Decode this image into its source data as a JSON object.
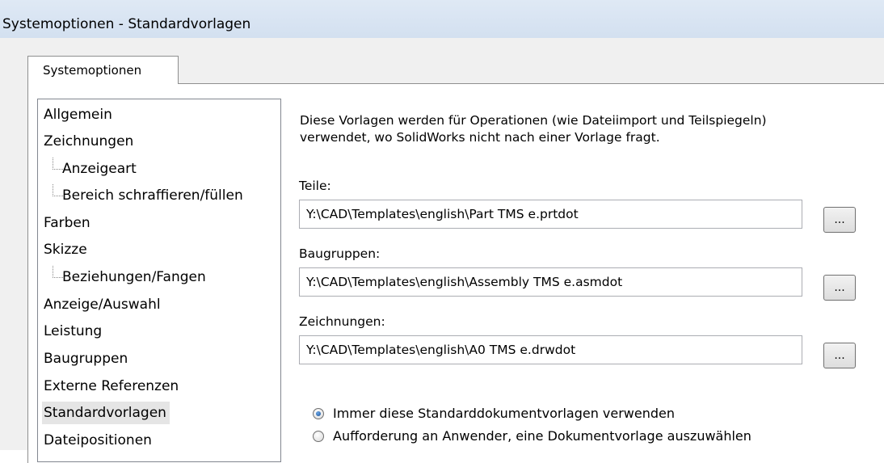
{
  "window": {
    "title": "Systemoptionen - Standardvorlagen"
  },
  "tab": {
    "label": "Systemoptionen"
  },
  "tree": {
    "items": [
      {
        "label": "Allgemein"
      },
      {
        "label": "Zeichnungen"
      },
      {
        "label": "Anzeigeart"
      },
      {
        "label": "Bereich schraffieren/füllen"
      },
      {
        "label": "Farben"
      },
      {
        "label": "Skizze"
      },
      {
        "label": "Beziehungen/Fangen"
      },
      {
        "label": "Anzeige/Auswahl"
      },
      {
        "label": "Leistung"
      },
      {
        "label": "Baugruppen"
      },
      {
        "label": "Externe Referenzen"
      },
      {
        "label": "Standardvorlagen"
      },
      {
        "label": "Dateipositionen"
      }
    ],
    "selected": "Standardvorlagen"
  },
  "description": {
    "line1": "Diese Vorlagen werden für Operationen (wie Dateiimport und Teilspiegeln)",
    "line2": "verwendet, wo SolidWorks nicht nach einer Vorlage fragt."
  },
  "fields": [
    {
      "label": "Teile:",
      "value": "Y:\\CAD\\Templates\\english\\Part TMS e.prtdot",
      "button": "..."
    },
    {
      "label": "Baugruppen:",
      "value": "Y:\\CAD\\Templates\\english\\Assembly TMS e.asmdot",
      "button": "..."
    },
    {
      "label": "Zeichnungen:",
      "value": "Y:\\CAD\\Templates\\english\\A0 TMS e.drwdot",
      "button": "..."
    }
  ],
  "radios": [
    {
      "label": "Immer diese Standarddokumentvorlagen verwenden",
      "checked": true
    },
    {
      "label": "Aufforderung an Anwender, eine Dokumentvorlage auszuwählen",
      "checked": false
    }
  ]
}
